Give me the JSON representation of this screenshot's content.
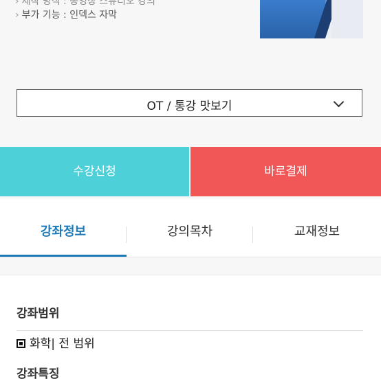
{
  "course_info": {
    "line1": "제작 방식 : 동영상 스튜디오 강의",
    "line2": "부가 기능 : 인덱스 자막"
  },
  "lecture_select": {
    "selected": "OT / 통강 맛보기"
  },
  "actions": {
    "enroll_label": "수강신청",
    "pay_label": "바로결제"
  },
  "tabs": [
    {
      "label": "강좌정보",
      "active": true
    },
    {
      "label": "강의목차",
      "active": false
    },
    {
      "label": "교재정보",
      "active": false
    }
  ],
  "content": {
    "scope_heading": "강좌범위",
    "scope_value": "화학| 전 범위",
    "features_heading": "강좌특징"
  },
  "colors": {
    "enroll": "#4dd0d8",
    "pay": "#f05756",
    "active_tab": "#1d7ab8"
  }
}
